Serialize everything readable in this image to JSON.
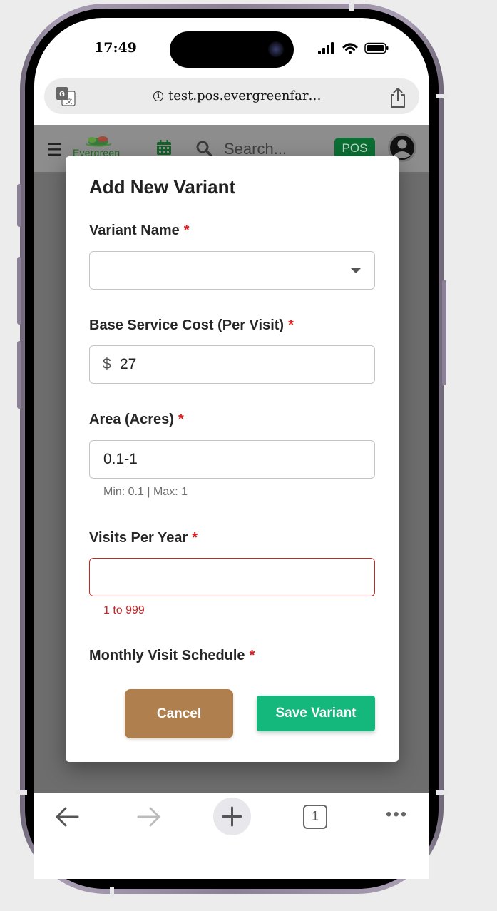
{
  "status_bar": {
    "time": "17:49"
  },
  "browser": {
    "url": "test.pos.evergreenfar…",
    "tab_count": "1"
  },
  "app_header": {
    "logo_text": "Evergreen",
    "search_placeholder": "Search...",
    "pos_badge": "POS"
  },
  "modal": {
    "title": "Add New Variant",
    "required_mark": "*",
    "variant_name": {
      "label": "Variant Name",
      "value": ""
    },
    "base_cost": {
      "label": "Base Service Cost (Per Visit)",
      "prefix": "$",
      "value": "27"
    },
    "area": {
      "label": "Area (Acres)",
      "value": "0.1-1",
      "helper": "Min: 0.1 | Max: 1"
    },
    "visits": {
      "label": "Visits Per Year",
      "value": "",
      "helper": "1 to 999"
    },
    "schedule": {
      "label": "Monthly Visit Schedule"
    },
    "cancel_label": "Cancel",
    "save_label": "Save Variant"
  },
  "colors": {
    "save_button": "#14b87c",
    "cancel_button": "#b07f4e",
    "required": "#e0191c",
    "error": "#c62828",
    "pos_badge": "#0b6e33"
  }
}
